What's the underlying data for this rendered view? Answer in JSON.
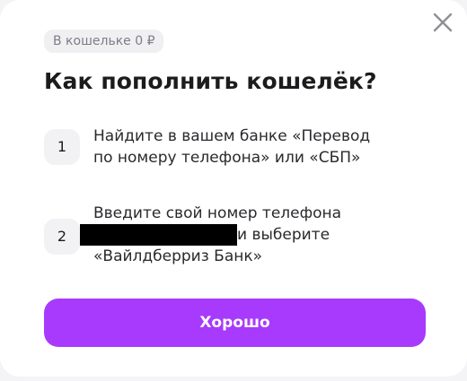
{
  "modal": {
    "badge": "В кошельке 0 ₽",
    "title": "Как пополнить кошелёк?",
    "close_icon": "close-icon",
    "steps": [
      {
        "number": "1",
        "line1": "Найдите в вашем банке «Перевод",
        "line2": "по номеру телефона» или «СБП»"
      },
      {
        "number": "2",
        "line1": "Введите свой номер телефона",
        "line2_after_redacted": "и выберите",
        "line3": "«Вайлдберриз Банк»"
      }
    ],
    "ok_button": "Хорошо"
  },
  "colors": {
    "accent": "#a73afd",
    "badge_bg": "#f0f0f3",
    "badge_text": "#7d7d89",
    "title": "#1c1c1e"
  }
}
